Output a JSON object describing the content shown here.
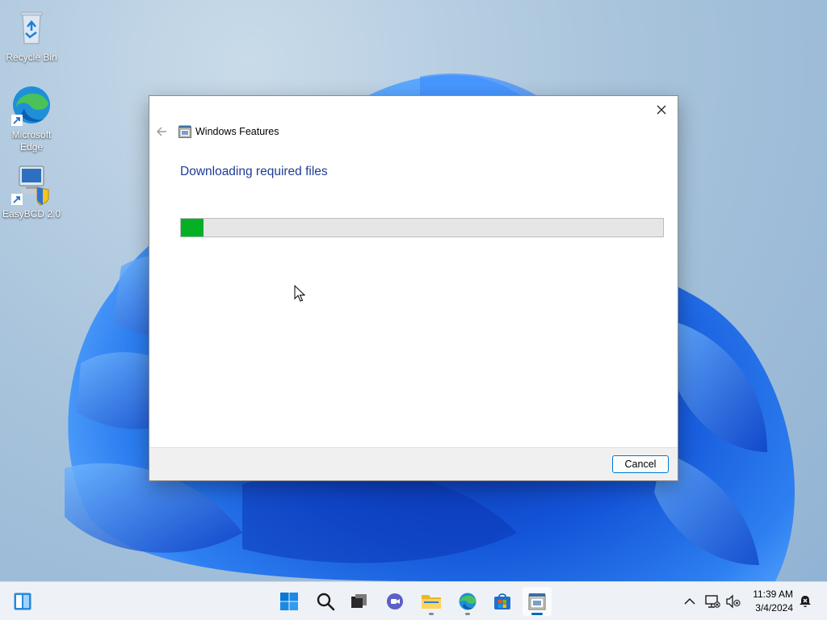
{
  "desktop": {
    "icons": [
      {
        "label": "Recycle Bin",
        "icon": "recycle-bin-icon"
      },
      {
        "label": "Microsoft Edge",
        "icon": "edge-icon"
      },
      {
        "label": "EasyBCD 2.0",
        "icon": "easybcd-icon"
      }
    ]
  },
  "dialog": {
    "title": "Windows Features",
    "heading": "Downloading required files",
    "progress": 0.047,
    "cancel_label": "Cancel",
    "progress_color": "#06b025",
    "heading_color": "#1e3c94"
  },
  "taskbar": {
    "apps": [
      {
        "name": "widgets",
        "icon": "widgets-icon"
      },
      {
        "name": "start",
        "icon": "windows-start-icon"
      },
      {
        "name": "search",
        "icon": "search-icon"
      },
      {
        "name": "task-view",
        "icon": "task-view-icon"
      },
      {
        "name": "chat",
        "icon": "chat-icon"
      },
      {
        "name": "file-explorer",
        "icon": "folder-icon"
      },
      {
        "name": "edge",
        "icon": "edge-icon"
      },
      {
        "name": "store",
        "icon": "store-icon"
      },
      {
        "name": "windows-features",
        "icon": "windows-features-icon"
      }
    ],
    "clock": {
      "time": "11:39 AM",
      "date": "3/4/2024"
    },
    "accent_color": "#0067c0"
  }
}
